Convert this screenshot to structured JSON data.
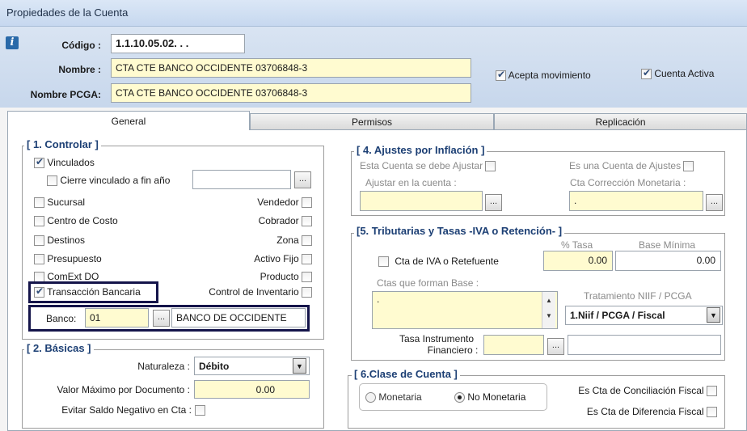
{
  "window": {
    "title": "Propiedades de la Cuenta"
  },
  "header": {
    "codigo_label": "Código :",
    "codigo_value": "1.1.10.05.02. . .",
    "nombre_label": "Nombre :",
    "nombre_value": "CTA CTE BANCO OCCIDENTE 03706848-3",
    "nombre_pcga_label": "Nombre PCGA:",
    "nombre_pcga_value": "CTA CTE BANCO OCCIDENTE 03706848-3",
    "acepta_movimiento": {
      "label": "Acepta movimiento",
      "checked": true
    },
    "cuenta_activa": {
      "label": "Cuenta Activa",
      "checked": true
    }
  },
  "tabs": [
    {
      "label": "General",
      "active": true
    },
    {
      "label": "Permisos",
      "active": false
    },
    {
      "label": "Replicación",
      "active": false
    }
  ],
  "controlar": {
    "title": "[ 1. Controlar ]",
    "vinculados": {
      "label": "Vinculados",
      "checked": true
    },
    "cierre": {
      "label": "Cierre vinculado a fin año",
      "checked": false,
      "value": ""
    },
    "left_items": [
      {
        "label": "Sucursal",
        "checked": false
      },
      {
        "label": "Centro de Costo",
        "checked": false
      },
      {
        "label": "Destinos",
        "checked": false
      },
      {
        "label": "Presupuesto",
        "checked": false
      },
      {
        "label": "ComExt DO",
        "checked": false
      },
      {
        "label": "Transacción Bancaria",
        "checked": true
      }
    ],
    "right_items": [
      {
        "label": "Vendedor",
        "checked": false
      },
      {
        "label": "Cobrador",
        "checked": false
      },
      {
        "label": "Zona",
        "checked": false
      },
      {
        "label": "Activo Fijo",
        "checked": false
      },
      {
        "label": "Producto",
        "checked": false
      },
      {
        "label": "Control de Inventario",
        "checked": false
      }
    ],
    "banco_label": "Banco:",
    "banco_code": "01",
    "banco_name": "BANCO DE OCCIDENTE",
    "dots": "..."
  },
  "basicas": {
    "title": "[ 2. Básicas ]",
    "naturaleza_label": "Naturaleza :",
    "naturaleza_value": "Débito",
    "valor_label": "Valor Máximo por Documento :",
    "valor_value": "0.00",
    "evitar_label": "Evitar Saldo Negativo en Cta :"
  },
  "ajustes": {
    "title": "[ 4. Ajustes por Inflación ]",
    "esta_cuenta_label": "Esta Cuenta  se debe Ajustar",
    "es_cuenta_ajustes_label": "Es una Cuenta de Ajustes",
    "ajustar_label": "Ajustar en la cuenta :",
    "cta_correccion_label": "Cta Corrección Monetaria :",
    "cta_correccion_value": "."
  },
  "tributarias": {
    "title": "[5. Tributarias y Tasas  -IVA o Retención- ]",
    "tasa_label": "% Tasa",
    "base_label": "Base Mínima",
    "cta_iva_label": "Cta de IVA o Retefuente",
    "tasa_value": "0.00",
    "base_value": "0.00",
    "ctas_base_label": "Ctas que forman Base :",
    "ctas_base_value": ".",
    "tratamiento_label": "Tratamiento NIIF / PCGA",
    "tratamiento_value": "1.Niif / PCGA / Fiscal",
    "tasa_instrumento_label_1": "Tasa Instrumento",
    "tasa_instrumento_label_2": "Financiero :"
  },
  "clase": {
    "title": "[ 6.Clase de Cuenta ]",
    "monetaria_label": "Monetaria",
    "no_monetaria_label": "No Monetaria",
    "selected": "No Monetaria",
    "conciliacion_label": "Es Cta de Conciliación Fiscal",
    "diferencia_label": "Es Cta de Diferencia Fiscal"
  }
}
